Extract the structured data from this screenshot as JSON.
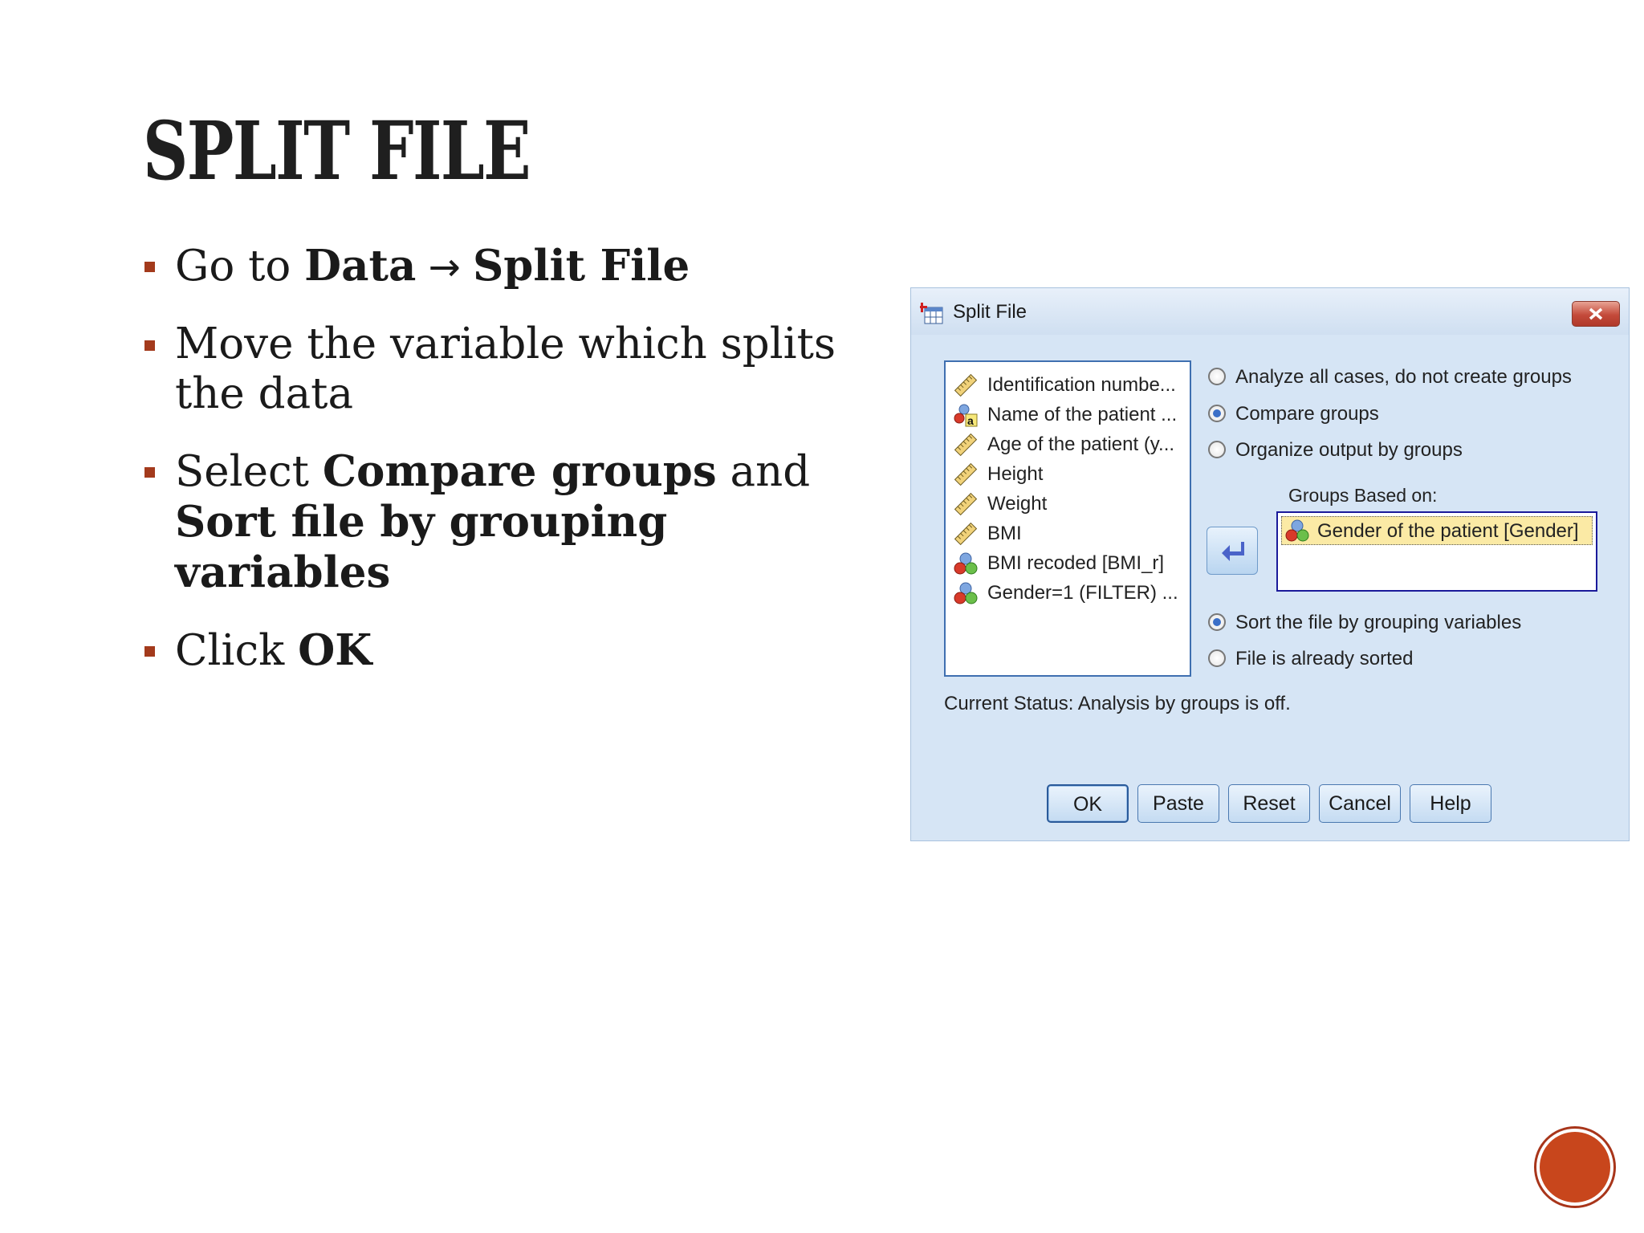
{
  "slide": {
    "title": "SPLIT FILE",
    "bullets": [
      {
        "parts": [
          {
            "text": "Go to "
          },
          {
            "text": "Data",
            "bold": true
          },
          {
            "text": " → ",
            "arrow": true
          },
          {
            "text": "Split File",
            "bold": true
          }
        ]
      },
      {
        "parts": [
          {
            "text": "Move the variable which splits the data"
          }
        ]
      },
      {
        "parts": [
          {
            "text": "Select "
          },
          {
            "text": "Compare groups",
            "bold": true
          },
          {
            "text": " and "
          },
          {
            "text": "Sort file by grouping variables",
            "bold": true,
            "newline": true
          }
        ]
      },
      {
        "parts": [
          {
            "text": "Click "
          },
          {
            "text": "OK",
            "bold": true
          }
        ]
      }
    ],
    "accent_color": "#a33a1c"
  },
  "dialog": {
    "title": "Split File",
    "variables": [
      {
        "label": "Identification numbe...",
        "icon": "ruler-icon"
      },
      {
        "label": "Name of the patient ...",
        "icon": "nominal-string-icon"
      },
      {
        "label": "Age of the patient (y...",
        "icon": "ruler-icon"
      },
      {
        "label": "Height",
        "icon": "ruler-icon"
      },
      {
        "label": "Weight",
        "icon": "ruler-icon"
      },
      {
        "label": "BMI",
        "icon": "ruler-icon"
      },
      {
        "label": "BMI recoded [BMI_r]",
        "icon": "nominal-icon"
      },
      {
        "label": "Gender=1 (FILTER) ...",
        "icon": "nominal-icon"
      }
    ],
    "options": {
      "analyze_all": {
        "label": "Analyze all cases, do not create groups",
        "selected": false
      },
      "compare_groups": {
        "label": "Compare groups",
        "selected": true
      },
      "organize_output": {
        "label": "Organize output by groups",
        "selected": false
      }
    },
    "groups_label": "Groups Based on:",
    "groups": [
      {
        "label": "Gender of the patient [Gender]",
        "icon": "nominal-icon"
      }
    ],
    "sort_options": {
      "sort_file": {
        "label": "Sort the file by grouping variables",
        "selected": true
      },
      "already_sorted": {
        "label": "File is already sorted",
        "selected": false
      }
    },
    "status": "Current Status: Analysis by groups is off.",
    "buttons": {
      "ok": "OK",
      "paste": "Paste",
      "reset": "Reset",
      "cancel": "Cancel",
      "help": "Help"
    }
  }
}
